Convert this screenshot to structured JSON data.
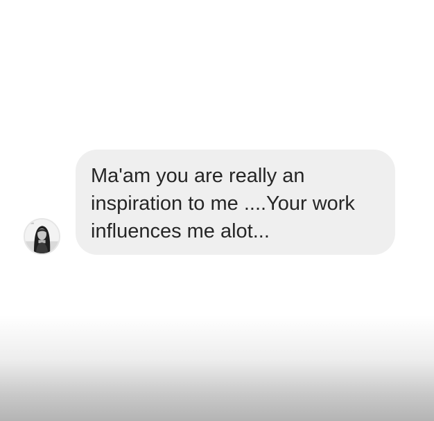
{
  "conversation": {
    "messages": [
      {
        "sender_avatar_icon": "profile-photo-icon",
        "text": "Ma'am you are really an\ninspiration to me ....Your work\ninfluences me alot..."
      }
    ]
  },
  "colors": {
    "bubble_background": "#efefef",
    "text": "#262626",
    "background": "#ffffff"
  }
}
